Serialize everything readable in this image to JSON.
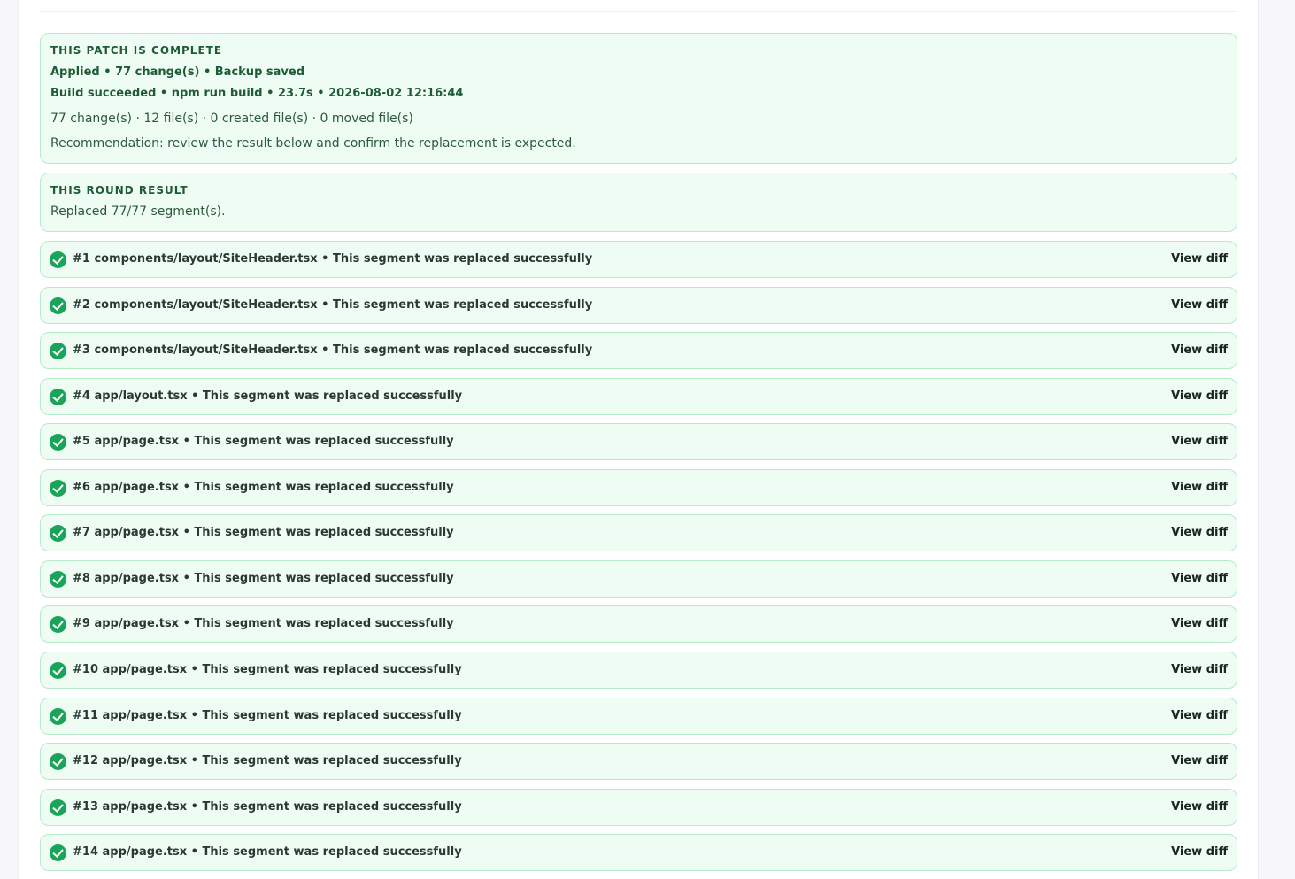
{
  "summary": {
    "eyebrow": "THIS PATCH IS COMPLETE",
    "applied_line": "Applied • 77 change(s) • Backup saved",
    "build_line": "Build succeeded • npm run build • 23.7s • 2026-08-02 12:16:44",
    "stats_line": "77 change(s) · 12 file(s) · 0 created file(s) · 0 moved file(s)",
    "recommendation": "Recommendation: review the result below and confirm the replacement is expected."
  },
  "round": {
    "eyebrow": "THIS ROUND RESULT",
    "result": "Replaced 77/77 segment(s)."
  },
  "segments": [
    {
      "label": "#1 components/layout/SiteHeader.tsx • This segment was replaced successfully",
      "action": "View diff",
      "status": "success",
      "icon": "check-circle-icon"
    },
    {
      "label": "#2 components/layout/SiteHeader.tsx • This segment was replaced successfully",
      "action": "View diff",
      "status": "success",
      "icon": "check-circle-icon"
    },
    {
      "label": "#3 components/layout/SiteHeader.tsx • This segment was replaced successfully",
      "action": "View diff",
      "status": "success",
      "icon": "check-circle-icon"
    },
    {
      "label": "#4 app/layout.tsx • This segment was replaced successfully",
      "action": "View diff",
      "status": "success",
      "icon": "check-circle-icon"
    },
    {
      "label": "#5 app/page.tsx • This segment was replaced successfully",
      "action": "View diff",
      "status": "success",
      "icon": "check-circle-icon"
    },
    {
      "label": "#6 app/page.tsx • This segment was replaced successfully",
      "action": "View diff",
      "status": "success",
      "icon": "check-circle-icon"
    },
    {
      "label": "#7 app/page.tsx • This segment was replaced successfully",
      "action": "View diff",
      "status": "success",
      "icon": "check-circle-icon"
    },
    {
      "label": "#8 app/page.tsx • This segment was replaced successfully",
      "action": "View diff",
      "status": "success",
      "icon": "check-circle-icon"
    },
    {
      "label": "#9 app/page.tsx • This segment was replaced successfully",
      "action": "View diff",
      "status": "success",
      "icon": "check-circle-icon"
    },
    {
      "label": "#10 app/page.tsx • This segment was replaced successfully",
      "action": "View diff",
      "status": "success",
      "icon": "check-circle-icon"
    },
    {
      "label": "#11 app/page.tsx • This segment was replaced successfully",
      "action": "View diff",
      "status": "success",
      "icon": "check-circle-icon"
    },
    {
      "label": "#12 app/page.tsx • This segment was replaced successfully",
      "action": "View diff",
      "status": "success",
      "icon": "check-circle-icon"
    },
    {
      "label": "#13 app/page.tsx • This segment was replaced successfully",
      "action": "View diff",
      "status": "success",
      "icon": "check-circle-icon"
    },
    {
      "label": "#14 app/page.tsx • This segment was replaced successfully",
      "action": "View diff",
      "status": "success",
      "icon": "check-circle-icon"
    }
  ],
  "colors": {
    "card_background": "#effcf3",
    "card_border": "#b6ebc9",
    "success_icon": "#1aa45a",
    "heading_text": "#1e5b37"
  }
}
